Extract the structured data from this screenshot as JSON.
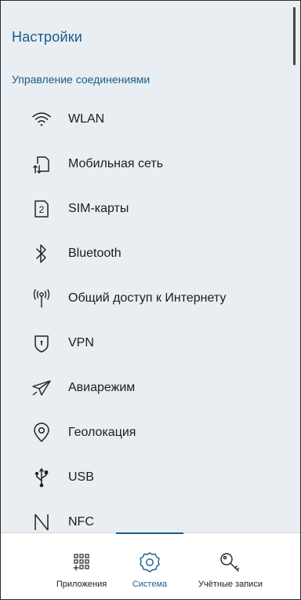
{
  "header": {
    "title": "Настройки"
  },
  "section": {
    "title": "Управление соединениями"
  },
  "items": [
    {
      "label": "WLAN",
      "icon": "wifi-icon"
    },
    {
      "label": "Мобильная сеть",
      "icon": "mobile-network-icon"
    },
    {
      "label": "SIM-карты",
      "icon": "sim-card-icon"
    },
    {
      "label": "Bluetooth",
      "icon": "bluetooth-icon"
    },
    {
      "label": "Общий доступ к Интернету",
      "icon": "hotspot-icon"
    },
    {
      "label": "VPN",
      "icon": "vpn-shield-icon"
    },
    {
      "label": "Авиарежим",
      "icon": "airplane-icon"
    },
    {
      "label": "Геолокация",
      "icon": "location-pin-icon"
    },
    {
      "label": "USB",
      "icon": "usb-icon"
    },
    {
      "label": "NFC",
      "icon": "nfc-icon"
    }
  ],
  "bottom_nav": {
    "items": [
      {
        "label": "Приложения",
        "icon": "apps-grid-icon",
        "active": false
      },
      {
        "label": "Система",
        "icon": "gear-icon",
        "active": true
      },
      {
        "label": "Учётные записи",
        "icon": "key-icon",
        "active": false
      }
    ]
  },
  "colors": {
    "accent": "#1a5c8a",
    "background": "#e9eef2",
    "nav_background": "#ffffff"
  }
}
